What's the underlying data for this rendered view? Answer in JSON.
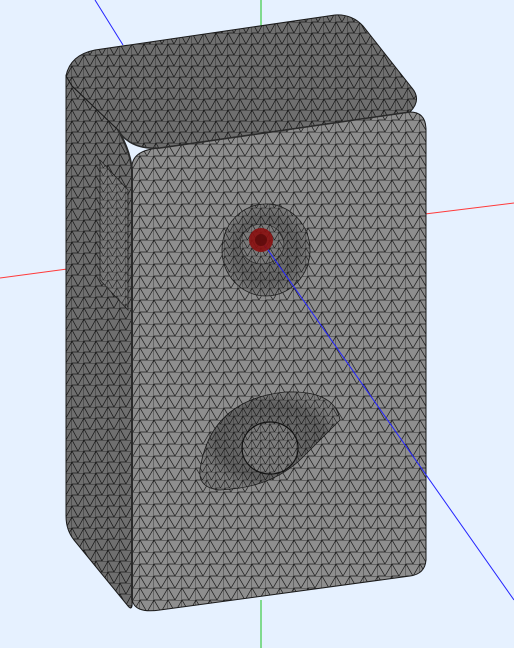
{
  "viewport": {
    "background": "#e6f1ff",
    "axes": {
      "x_axis_color": "#ff3a3a",
      "y_axis_color": "#19c21e",
      "z_axis_color": "#2424ff"
    }
  },
  "model": {
    "name": "speaker-cabinet-mesh",
    "render_mode": "wireframe-on-shaded",
    "surface_color": "#8e8e8e",
    "wire_color": "#1a1a1a",
    "features": [
      {
        "name": "tweeter-opening"
      },
      {
        "name": "woofer-port"
      },
      {
        "name": "selected-vertex-marker",
        "color": "#8b1010"
      }
    ]
  }
}
